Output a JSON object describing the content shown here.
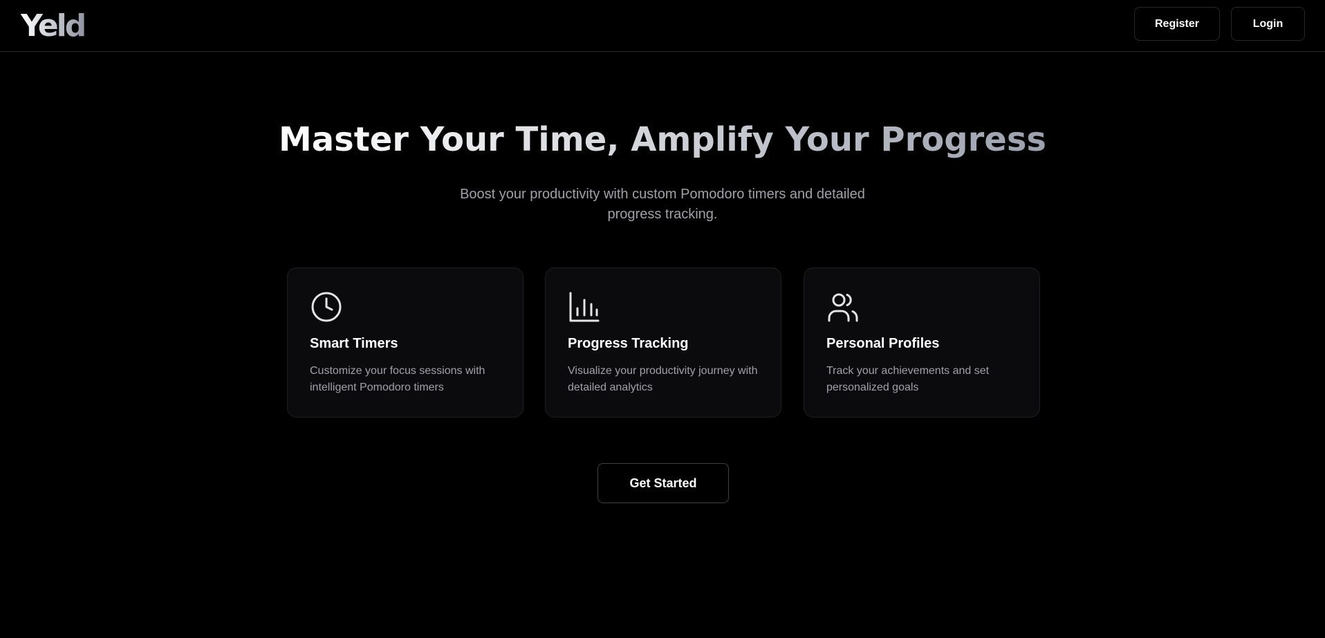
{
  "header": {
    "logo": "Yeld",
    "register_label": "Register",
    "login_label": "Login"
  },
  "hero": {
    "title": "Master Your Time, Amplify Your Progress",
    "subtitle": "Boost your productivity with custom Pomodoro timers and detailed progress tracking."
  },
  "features": [
    {
      "icon": "clock-icon",
      "title": "Smart Timers",
      "description": "Customize your focus sessions with intelligent Pomodoro timers"
    },
    {
      "icon": "bar-chart-icon",
      "title": "Progress Tracking",
      "description": "Visualize your productivity journey with detailed analytics"
    },
    {
      "icon": "users-icon",
      "title": "Personal Profiles",
      "description": "Track your achievements and set personalized goals"
    }
  ],
  "cta": {
    "label": "Get Started"
  },
  "colors": {
    "background": "#000000",
    "card_background": "#0b0b0d",
    "border": "#27272a",
    "muted_text": "#a1a1aa",
    "text": "#ffffff"
  }
}
